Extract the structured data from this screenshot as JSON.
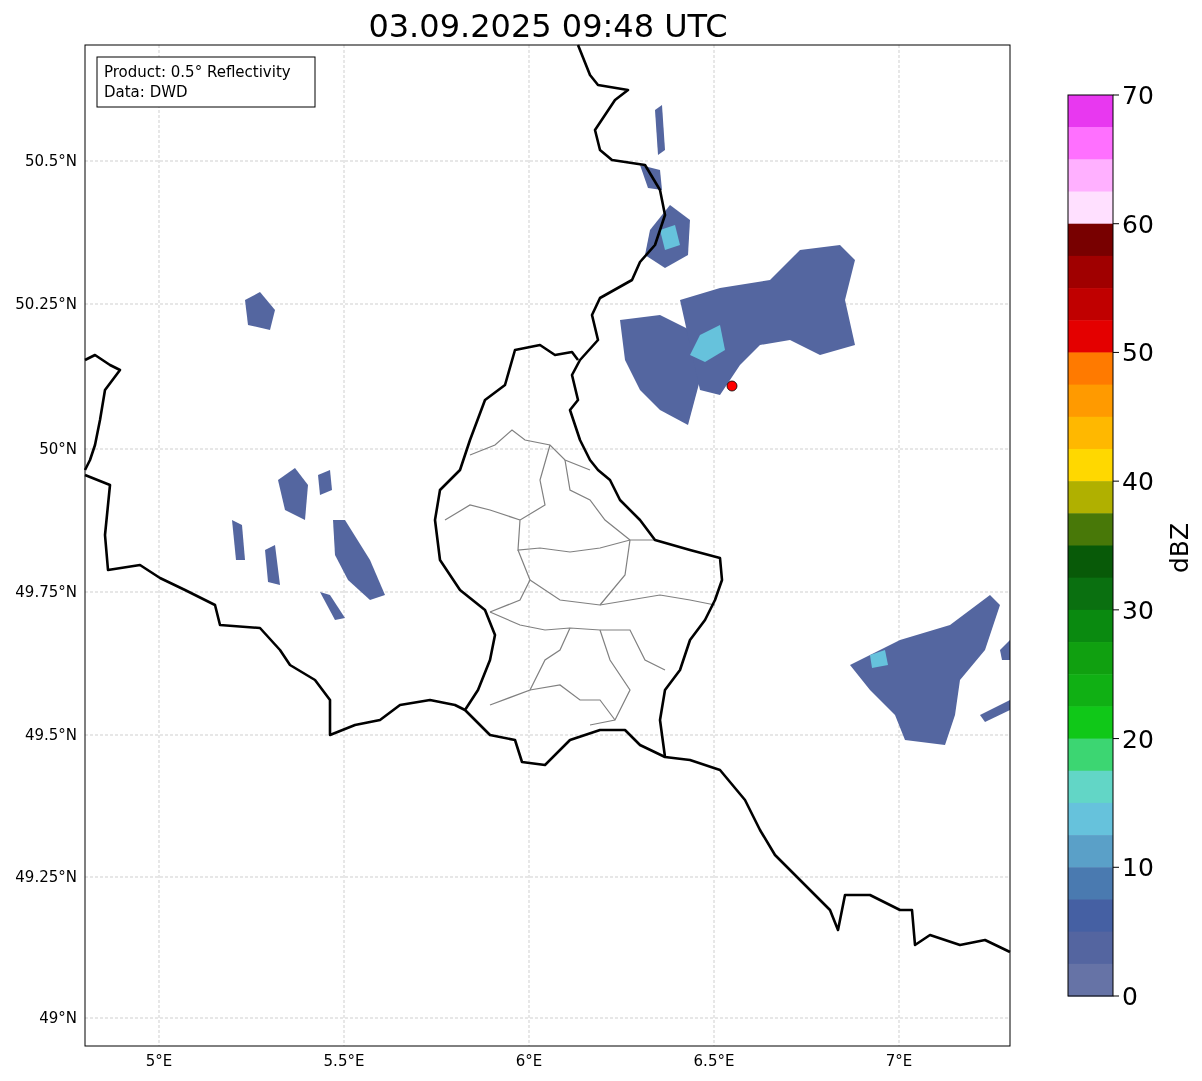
{
  "title": "03.09.2025 09:48 UTC",
  "legend": [
    "Product: 0.5° Reflectivity",
    "Data: DWD"
  ],
  "map": {
    "lon_ticks": [
      "5°E",
      "5.5°E",
      "6°E",
      "6.5°E",
      "7°E"
    ],
    "lat_ticks": [
      "50.5°N",
      "50.25°N",
      "50°N",
      "49.75°N",
      "49.5°N",
      "49.25°N",
      "49°N"
    ]
  },
  "colorbar": {
    "label": "dBZ",
    "ticks": [
      "70",
      "60",
      "50",
      "40",
      "30",
      "20",
      "10",
      "0"
    ],
    "bins": [
      {
        "color": "#e838f0"
      },
      {
        "color": "#ff70ff"
      },
      {
        "color": "#ffb0ff"
      },
      {
        "color": "#ffe0ff"
      },
      {
        "color": "#780000"
      },
      {
        "color": "#a00000"
      },
      {
        "color": "#c00000"
      },
      {
        "color": "#e40000"
      },
      {
        "color": "#ff7a00"
      },
      {
        "color": "#ff9a00"
      },
      {
        "color": "#ffb800"
      },
      {
        "color": "#ffd800"
      },
      {
        "color": "#b0b000"
      },
      {
        "color": "#487808"
      },
      {
        "color": "#085a08"
      },
      {
        "color": "#0a7010"
      },
      {
        "color": "#0a8a10"
      },
      {
        "color": "#10a010"
      },
      {
        "color": "#10b014"
      },
      {
        "color": "#10c818"
      },
      {
        "color": "#3cd672"
      },
      {
        "color": "#62d6c6"
      },
      {
        "color": "#66c2dc"
      },
      {
        "color": "#5aa0c8"
      },
      {
        "color": "#4a7ab0"
      },
      {
        "color": "#4560a3"
      },
      {
        "color": "#5465a0"
      },
      {
        "color": "#6673a6"
      }
    ]
  }
}
